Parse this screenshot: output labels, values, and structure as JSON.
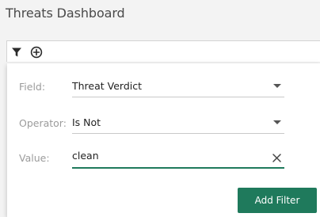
{
  "page": {
    "title": "Threats Dashboard"
  },
  "toolbar": {
    "filter_icon": "filter-icon",
    "add_icon": "add-circle-icon"
  },
  "filter_form": {
    "field": {
      "label": "Field:",
      "value": "Threat Verdict"
    },
    "operator": {
      "label": "Operator:",
      "value": "Is Not"
    },
    "value": {
      "label": "Value:",
      "input_value": "clean"
    },
    "add_button_label": "Add Filter"
  },
  "colors": {
    "accent": "#1f7a5c",
    "background": "#f3f3f3",
    "label_gray": "#9b9b9b"
  }
}
